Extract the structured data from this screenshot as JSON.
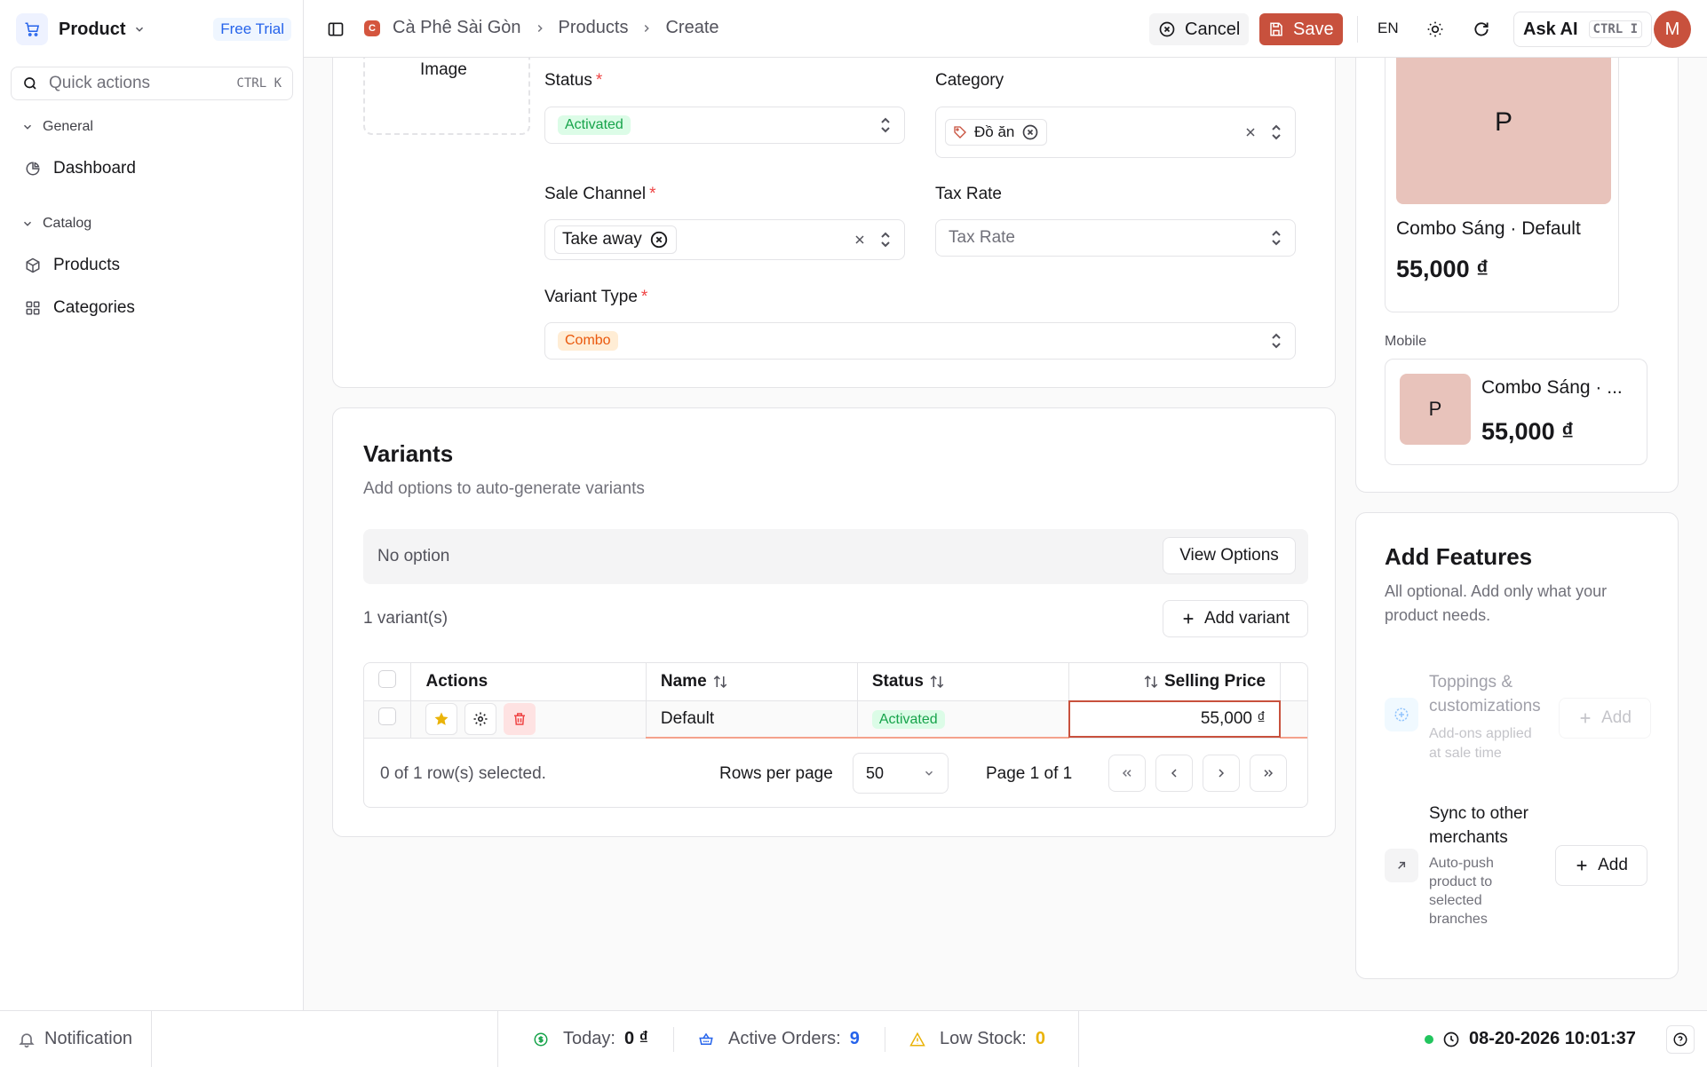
{
  "sidebar": {
    "app_name": "Product",
    "trial_badge": "Free Trial",
    "quick_actions": {
      "placeholder": "Quick actions",
      "shortcut": "CTRL K"
    },
    "groups": [
      {
        "label": "General",
        "items": [
          {
            "label": "Dashboard",
            "icon": "pie-chart-icon"
          }
        ]
      },
      {
        "label": "Catalog",
        "items": [
          {
            "label": "Products",
            "icon": "box-icon"
          },
          {
            "label": "Categories",
            "icon": "grid-icon"
          }
        ]
      }
    ]
  },
  "header": {
    "breadcrumbs": [
      "Cà Phê Sài Gòn",
      "Products",
      "Create"
    ],
    "shop_initial": "C",
    "cancel_label": "Cancel",
    "save_label": "Save",
    "language": "EN",
    "ask_ai_label": "Ask AI",
    "ask_ai_shortcut": "CTRL I",
    "avatar_initial": "M"
  },
  "form": {
    "image_label": "Image",
    "status": {
      "label": "Status",
      "value": "Activated"
    },
    "category": {
      "label": "Category",
      "chip": "Đồ ăn"
    },
    "sale_channel": {
      "label": "Sale Channel",
      "chip": "Take away"
    },
    "tax_rate": {
      "label": "Tax Rate",
      "placeholder": "Tax Rate"
    },
    "variant_type": {
      "label": "Variant Type",
      "value": "Combo"
    }
  },
  "variants": {
    "title": "Variants",
    "subtitle": "Add options to auto-generate variants",
    "no_option": "No option",
    "view_options_label": "View Options",
    "count_text": "1 variant(s)",
    "add_variant_label": "Add variant",
    "columns": {
      "actions": "Actions",
      "name": "Name",
      "status": "Status",
      "price": "Selling Price"
    },
    "rows": [
      {
        "name": "Default",
        "status": "Activated",
        "price": "55,000 ₫"
      }
    ],
    "selected_text": "0 of 1 row(s) selected.",
    "rows_per_page_label": "Rows per page",
    "rows_per_page": "50",
    "page_text": "Page 1 of 1"
  },
  "preview": {
    "initial": "P",
    "desktop_name": "Combo Sáng · Default",
    "desktop_price": "55,000 ₫",
    "mobile_label": "Mobile",
    "mobile_name": "Combo Sáng · ...",
    "mobile_price": "55,000 ₫"
  },
  "features": {
    "title": "Add Features",
    "subtitle_1": "All optional. Add only what your",
    "subtitle_2": "product needs.",
    "items": [
      {
        "title_1": "Toppings &",
        "title_2": "customizations",
        "desc_1": "Add-ons applied",
        "desc_2": "at sale time",
        "add_label": "Add",
        "enabled": false
      },
      {
        "title_1": "Sync to other",
        "title_2": "merchants",
        "desc_1": "Auto-push",
        "desc_2": "product to",
        "desc_3": "selected",
        "desc_4": "branches",
        "add_label": "Add",
        "enabled": true
      }
    ]
  },
  "statusbar": {
    "notification_label": "Notification",
    "today_label": "Today:",
    "today_value": "0 ₫",
    "active_orders_label": "Active Orders:",
    "active_orders_value": "9",
    "low_stock_label": "Low Stock:",
    "low_stock_value": "0",
    "datetime": "08-20-2026 10:01:37"
  },
  "colors": {
    "accent": "#c8513d",
    "success": "#16a34a",
    "link": "#2563eb",
    "warning": "#eab308"
  }
}
